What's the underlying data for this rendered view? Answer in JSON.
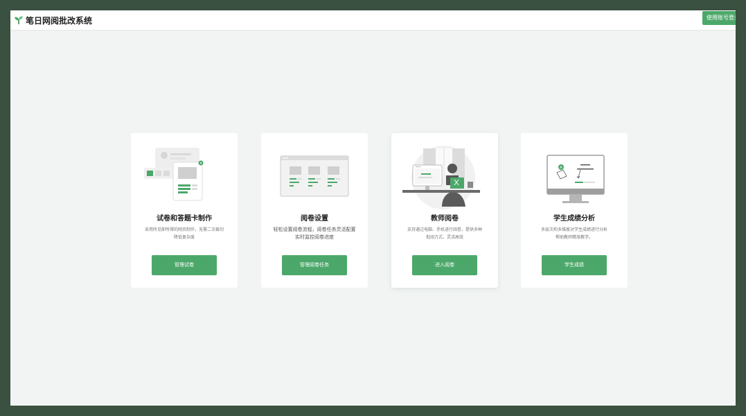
{
  "app": {
    "title": "笔日网阅批改系统",
    "logo_icon": "sprout-icon",
    "login_label": "使用账号登录"
  },
  "colors": {
    "accent": "#4ca86a",
    "background": "#f1f4f3",
    "frame": "#3a5040"
  },
  "cards": [
    {
      "title": "试卷和答题卡制作",
      "desc_line1": "采用所见即所得的网页制作，无需二次裁切",
      "desc_line2": "降低复杂度",
      "button": "管理试卷",
      "illustration": "exam-sheet-illustration"
    },
    {
      "title": "阅卷设置",
      "desc_line1": "轻松设置阅卷流程，阅卷任务灵活配置",
      "desc_line2": "实时监控阅卷进度",
      "button": "管理阅卷任务",
      "illustration": "dashboard-window-illustration"
    },
    {
      "title": "教师阅卷",
      "desc_line1": "支持通过电脑、手机进行阅卷，提供多种",
      "desc_line2": "批阅方式，灵活高效",
      "button": "进入阅卷",
      "illustration": "teacher-at-desk-illustration"
    },
    {
      "title": "学生成绩分析",
      "desc_line1": "多层次和多维度对学生成绩进行分析",
      "desc_line2": "帮助教师精准教学。",
      "button": "学生成绩",
      "illustration": "analysis-monitor-illustration"
    }
  ]
}
